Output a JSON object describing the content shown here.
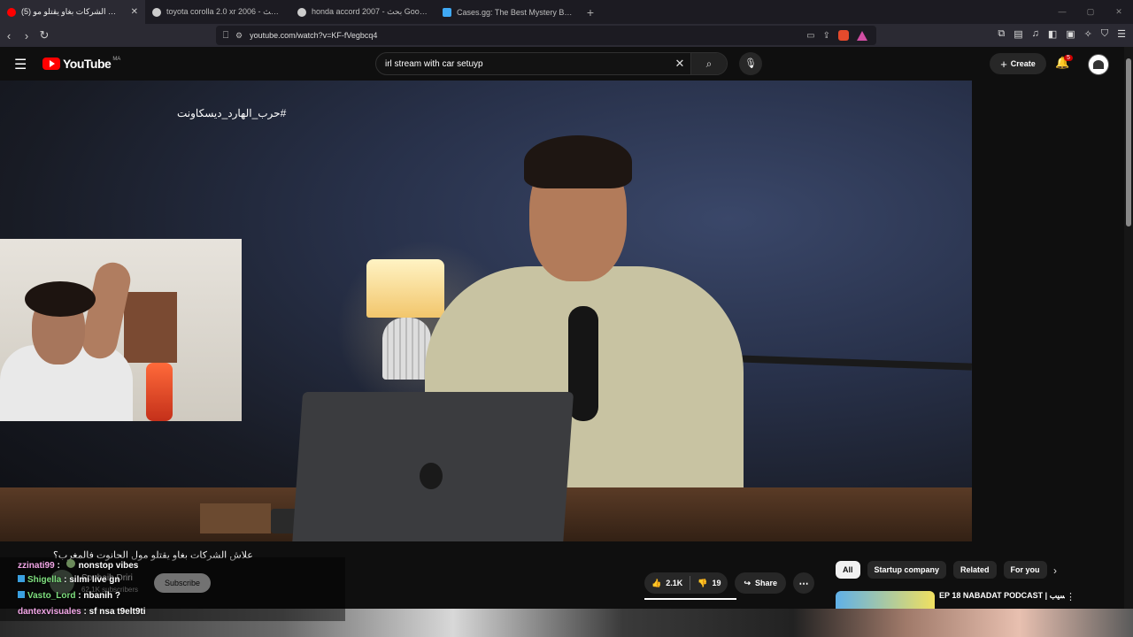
{
  "browser": {
    "tabs": [
      {
        "label": "(5) علاش الشركات بغاو يقتلو مو",
        "active": true,
        "fav_color": "#ff0000"
      },
      {
        "label": "toyota corolla 2.0 xr 2006 - بحث Goo",
        "active": false,
        "fav_color": "#cccccc"
      },
      {
        "label": "honda accord 2007 - بحث Google",
        "active": false,
        "fav_color": "#cccccc"
      },
      {
        "label": "Cases.gg: The Best Mystery Box Site",
        "active": false,
        "fav_color": "#3fa9f5"
      }
    ],
    "new_tab": "+",
    "url": "youtube.com/watch?v=KF-fVegbcq4"
  },
  "youtube": {
    "logo_text": "YouTube",
    "country_code": "MA",
    "search_query": "irl stream with car setuyp",
    "create_label": "Create",
    "notification_count": "5"
  },
  "video": {
    "hashtag": "#حرب_الهارد_ديسكاونت",
    "title": "علاش الشركات بغاو يقتلو مول الحانوت فالمغرب؟",
    "channel_name": "Souhaib Driri",
    "subscribers": "62.1K subscribers",
    "subscribe_label": "Subscribe",
    "likes": "2.1K",
    "dislikes": "19",
    "share_label": "Share"
  },
  "chat": [
    {
      "user": "zzinati99",
      "text": "nonstop vibes",
      "emote": true
    },
    {
      "user": "Shigella",
      "text": "silmi live gn",
      "badge": true
    },
    {
      "user": "Vasto_Lord",
      "text": "nbanih ?",
      "badge": true
    },
    {
      "user": "dantexvisuales",
      "text": "sf nsa t9elt9ti"
    }
  ],
  "chat_sep": " : ",
  "sidebar": {
    "chips": [
      "All",
      "Startup company",
      "Related",
      "For you"
    ],
    "rec_title": "EP 18 NABADAT PODCAST | سيب"
  },
  "icons": {
    "back": "‹",
    "forward": "›",
    "reload": "↻",
    "bookmark": "⎕",
    "menu": "☰",
    "clear": "✕",
    "search": "⌕",
    "mic": "🎙",
    "bell": "🔔",
    "like": "👍",
    "dislike": "👎",
    "share": "↪",
    "more": "⋯",
    "next": "›",
    "kebab": "⋮"
  }
}
